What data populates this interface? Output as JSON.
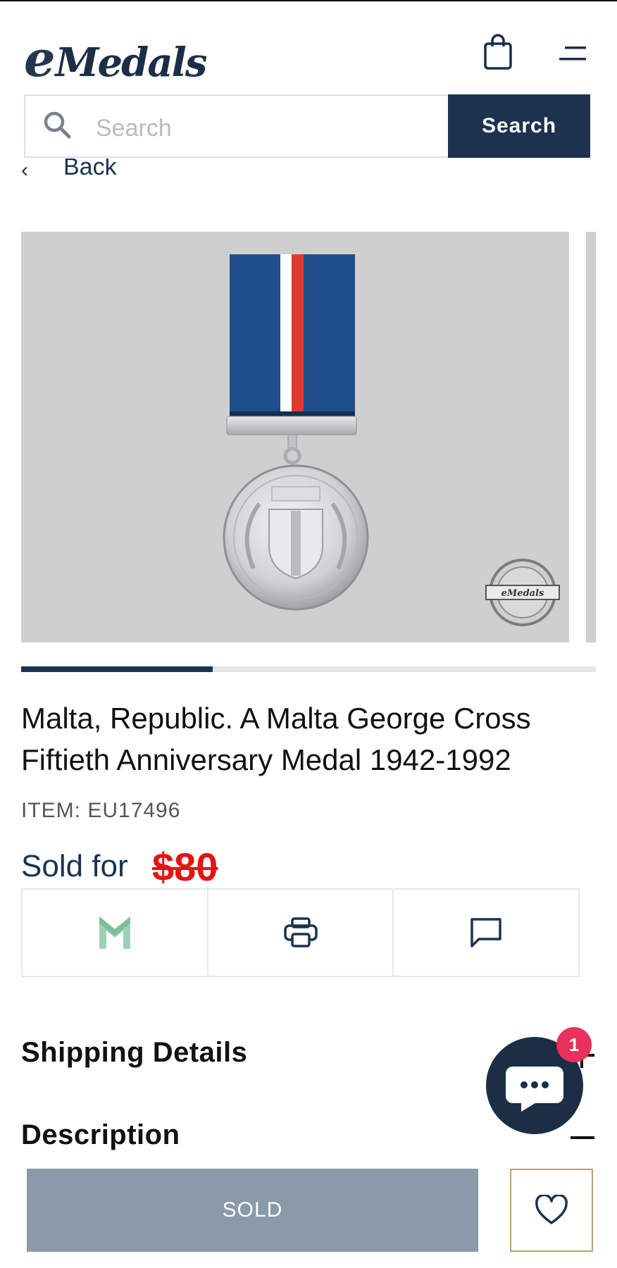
{
  "header": {
    "logo_e": "e",
    "logo_text": "Medals",
    "cart_icon": "shopping-bag-icon",
    "menu_icon": "hamburger-menu-icon"
  },
  "search": {
    "placeholder": "Search",
    "button_label": "Search"
  },
  "nav": {
    "back_label": "Back"
  },
  "gallery": {
    "image_alt": "Malta George Cross Fiftieth Anniversary Medal",
    "watermark_text": "eMedals",
    "progress_fraction": 0.333
  },
  "product": {
    "title": "Malta, Republic. A Malta George Cross Fiftieth Anniversary Medal 1942-1992",
    "item_label": "ITEM: EU17496",
    "sold_for_label": "Sold for",
    "price": "$80"
  },
  "actions": [
    {
      "name": "medal-brand-icon"
    },
    {
      "name": "print-icon"
    },
    {
      "name": "message-icon"
    }
  ],
  "sections": {
    "shipping_label": "Shipping Details",
    "description_label": "Description"
  },
  "chat": {
    "badge_count": "1"
  },
  "buy": {
    "sold_label": "SOLD"
  },
  "colors": {
    "navy": "#1c3350",
    "price_red": "#e41414",
    "sold_gray": "#8a9aa8",
    "badge_pink": "#e8315c"
  }
}
